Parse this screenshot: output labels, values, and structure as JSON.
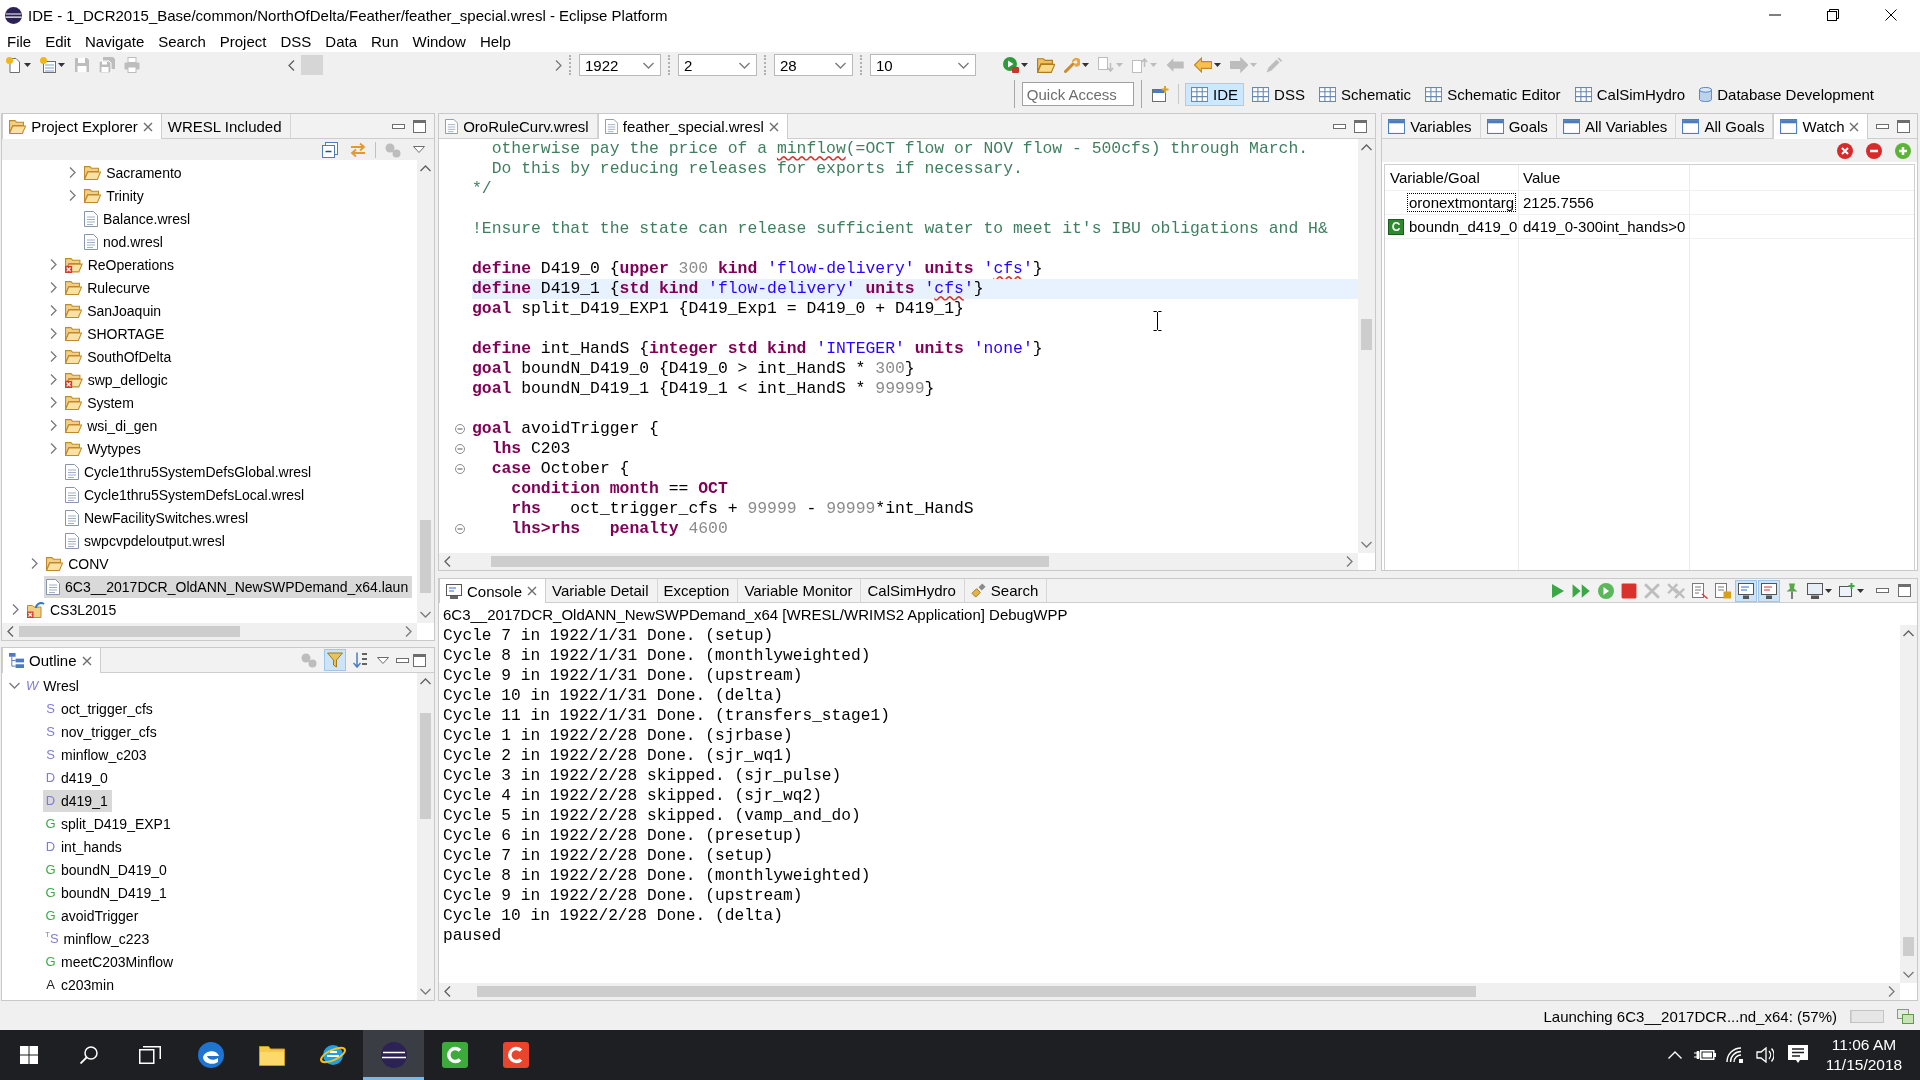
{
  "window": {
    "title": "IDE - 1_DCR2015_Base/common/NorthOfDelta/Feather/feather_special.wresl - Eclipse Platform"
  },
  "menu": [
    "File",
    "Edit",
    "Navigate",
    "Search",
    "Project",
    "DSS",
    "Data",
    "Run",
    "Window",
    "Help"
  ],
  "toolbar": {
    "left_buttons": [
      {
        "kind": "new-file",
        "dropdown": true,
        "disabled": false
      },
      {
        "kind": "new-item",
        "dropdown": true,
        "disabled": false
      },
      {
        "kind": "save",
        "dropdown": false,
        "disabled": true
      },
      {
        "kind": "save-all",
        "dropdown": false,
        "disabled": true
      },
      {
        "kind": "print",
        "dropdown": false,
        "disabled": true
      }
    ],
    "date_fields": [
      {
        "value": "1922"
      },
      {
        "value": "2"
      },
      {
        "value": "28"
      },
      {
        "value": "10"
      }
    ],
    "right_buttons": [
      {
        "kind": "run",
        "dropdown": true,
        "disabled": false
      },
      {
        "kind": "open-folder",
        "dropdown": false,
        "disabled": false
      },
      {
        "kind": "wrench",
        "dropdown": true,
        "disabled": false
      },
      {
        "kind": "next-annotation",
        "dropdown": true,
        "disabled": true
      },
      {
        "kind": "prev-annotation",
        "dropdown": true,
        "disabled": true
      },
      {
        "kind": "last-edit",
        "dropdown": false,
        "disabled": true
      },
      {
        "kind": "back",
        "dropdown": true,
        "disabled": false
      },
      {
        "kind": "forward",
        "dropdown": true,
        "disabled": true
      },
      {
        "kind": "pen",
        "dropdown": false,
        "disabled": true
      }
    ],
    "quick_access": {
      "placeholder": "Quick Access"
    },
    "perspectives": [
      {
        "label": "IDE",
        "kind": "table",
        "selected": true
      },
      {
        "label": "DSS",
        "kind": "table",
        "selected": false
      },
      {
        "label": "Schematic",
        "kind": "table",
        "selected": false
      },
      {
        "label": "Schematic Editor",
        "kind": "table",
        "selected": false
      },
      {
        "label": "CalSimHydro",
        "kind": "table",
        "selected": false
      },
      {
        "label": "Database Development",
        "kind": "database",
        "selected": false
      }
    ]
  },
  "project_explorer": {
    "tabs": [
      {
        "label": "Project Explorer",
        "kind": "explorer",
        "selected": true
      },
      {
        "label": "WRESL Included",
        "kind": "view",
        "selected": false
      }
    ],
    "toolbar": [
      {
        "kind": "collapse-all",
        "disabled": false
      },
      {
        "kind": "link",
        "disabled": false
      },
      {
        "kind": "filters",
        "disabled": true
      },
      {
        "kind": "view-menu",
        "disabled": false
      }
    ],
    "tree": [
      {
        "children": [
          {
            "children": [
              {
                "children": [
                  {
                    "label": "Sacramento",
                    "kind": "folder",
                    "error": false,
                    "expanded": false,
                    "selected": false
                  },
                  {
                    "label": "Trinity",
                    "kind": "folder",
                    "error": false,
                    "expanded": false,
                    "selected": false
                  },
                  {
                    "label": "Balance.wresl",
                    "kind": "file",
                    "selected": false
                  },
                  {
                    "label": "nod.wresl",
                    "kind": "file",
                    "selected": false
                  }
                ]
              },
              {
                "label": "ReOperations",
                "kind": "folder",
                "error": true,
                "expanded": false,
                "selected": false
              },
              {
                "label": "Rulecurve",
                "kind": "folder",
                "error": false,
                "expanded": false,
                "selected": false
              },
              {
                "label": "SanJoaquin",
                "kind": "folder",
                "error": false,
                "expanded": false,
                "selected": false
              },
              {
                "label": "SHORTAGE",
                "kind": "folder",
                "error": false,
                "expanded": false,
                "selected": false
              },
              {
                "label": "SouthOfDelta",
                "kind": "folder",
                "error": false,
                "expanded": false,
                "selected": false
              },
              {
                "label": "swp_dellogic",
                "kind": "folder",
                "error": true,
                "expanded": false,
                "selected": false
              },
              {
                "label": "System",
                "kind": "folder",
                "error": false,
                "expanded": false,
                "selected": false
              },
              {
                "label": "wsi_di_gen",
                "kind": "folder",
                "error": false,
                "expanded": false,
                "selected": false
              },
              {
                "label": "Wytypes",
                "kind": "folder",
                "error": false,
                "expanded": false,
                "selected": false
              },
              {
                "label": "Cycle1thru5SystemDefsGlobal.wresl",
                "kind": "file",
                "selected": false
              },
              {
                "label": "Cycle1thru5SystemDefsLocal.wresl",
                "kind": "file",
                "selected": false
              },
              {
                "label": "NewFacilitySwitches.wresl",
                "kind": "file",
                "selected": false
              },
              {
                "label": "swpcvpdeloutput.wresl",
                "kind": "file",
                "selected": false
              }
            ]
          },
          {
            "label": "CONV",
            "kind": "folder",
            "error": false,
            "expanded": false,
            "selected": false
          },
          {
            "label": "6C3__2017DCR_OldANN_NewSWPDemand_x64.laun",
            "kind": "file",
            "selected": true
          }
        ]
      },
      {
        "label": "CS3L2015",
        "kind": "project",
        "error": true,
        "expanded": false,
        "selected": false
      }
    ]
  },
  "outline": {
    "tabs": [
      {
        "label": "Outline",
        "kind": "outline",
        "selected": true
      }
    ],
    "toolbar": [
      {
        "kind": "filters",
        "disabled": true,
        "pressed": false
      },
      {
        "kind": "hide-fields",
        "disabled": false,
        "pressed": true
      },
      {
        "kind": "sort",
        "disabled": false,
        "pressed": false
      },
      {
        "kind": "view-menu",
        "disabled": false,
        "pressed": false
      }
    ],
    "tree": [
      {
        "label": "Wresl",
        "badge": "W",
        "kind": "root",
        "expanded": true,
        "selected": false,
        "children": [
          {
            "label": "oct_trigger_cfs",
            "badge": "S",
            "kind": "svar",
            "selected": false
          },
          {
            "label": "nov_trigger_cfs",
            "badge": "S",
            "kind": "svar",
            "selected": false
          },
          {
            "label": "minflow_c203",
            "badge": "S",
            "kind": "svar",
            "selected": false
          },
          {
            "label": "d419_0",
            "badge": "D",
            "kind": "dvar",
            "selected": false
          },
          {
            "label": "d419_1",
            "badge": "D",
            "kind": "dvar",
            "selected": true
          },
          {
            "label": "split_D419_EXP1",
            "badge": "G",
            "kind": "goal",
            "selected": false
          },
          {
            "label": "int_hands",
            "badge": "D",
            "kind": "dvar",
            "selected": false
          },
          {
            "label": "boundN_D419_0",
            "badge": "G",
            "kind": "goal",
            "selected": false
          },
          {
            "label": "boundN_D419_1",
            "badge": "G",
            "kind": "goal",
            "selected": false
          },
          {
            "label": "avoidTrigger",
            "badge": "G",
            "kind": "goal",
            "selected": false
          },
          {
            "label": "minflow_c223",
            "badge": "$^{T}$S",
            "kind": "svar",
            "selected": false
          },
          {
            "label": "meetC203Minflow",
            "badge": "G",
            "kind": "goal",
            "selected": false
          },
          {
            "label": "c203min",
            "badge": "A",
            "kind": "alias",
            "selected": false
          }
        ]
      }
    ]
  },
  "editor": {
    "tabs": [
      {
        "label": "OroRuleCurv.wresl",
        "selected": false
      },
      {
        "label": "feather_special.wresl",
        "selected": true
      }
    ],
    "lines": [
      {
        "fold": false,
        "current": false,
        "tokens": [
          {
            "kind": "comment",
            "text": "  otherwise pay the price of a "
          },
          {
            "kind": "comment",
            "text": "minflow",
            "misspelled": true
          },
          {
            "kind": "comment",
            "text": "(=OCT flow or NOV flow - 500cfs) through March."
          }
        ]
      },
      {
        "fold": false,
        "current": false,
        "tokens": [
          {
            "kind": "comment",
            "text": "  Do this by reducing releases for exports if necessary."
          }
        ]
      },
      {
        "fold": false,
        "current": false,
        "tokens": [
          {
            "kind": "comment",
            "text": "*/"
          }
        ]
      },
      {
        "fold": false,
        "current": false
      },
      {
        "fold": false,
        "current": false,
        "tokens": [
          {
            "kind": "comment",
            "text": "!Ensure that the state can release sufficient water to meet it's IBU obligations and H&"
          }
        ]
      },
      {
        "fold": false,
        "current": false
      },
      {
        "fold": false,
        "current": false,
        "tokens": [
          {
            "kind": "keyword",
            "text": "define"
          },
          {
            "kind": "plain",
            "text": " D419_0 {"
          },
          {
            "kind": "keyword",
            "text": "upper"
          },
          {
            "kind": "number",
            "text": " 300 "
          },
          {
            "kind": "keyword",
            "text": "kind"
          },
          {
            "kind": "string",
            "text": " 'flow-delivery' "
          },
          {
            "kind": "keyword",
            "text": "units"
          },
          {
            "kind": "string",
            "text": " '"
          },
          {
            "kind": "string",
            "text": "cfs",
            "misspelled": true
          },
          {
            "kind": "string",
            "text": "'"
          },
          {
            "kind": "plain",
            "text": "}"
          }
        ]
      },
      {
        "fold": false,
        "current": true,
        "tokens": [
          {
            "kind": "keyword",
            "text": "define"
          },
          {
            "kind": "plain",
            "text": " D419_1 {"
          },
          {
            "kind": "keyword",
            "text": "std kind"
          },
          {
            "kind": "string",
            "text": " 'flow-delivery' "
          },
          {
            "kind": "keyword",
            "text": "units"
          },
          {
            "kind": "string",
            "text": " '"
          },
          {
            "kind": "string",
            "text": "cfs",
            "misspelled": true
          },
          {
            "kind": "string",
            "text": "'"
          },
          {
            "kind": "plain",
            "text": "}"
          }
        ]
      },
      {
        "fold": false,
        "current": false,
        "tokens": [
          {
            "kind": "keyword",
            "text": "goal"
          },
          {
            "kind": "plain",
            "text": " split_D419_EXP1 {D419_Exp1 = D419_0 + D419_1}"
          }
        ]
      },
      {
        "fold": false,
        "current": false
      },
      {
        "fold": false,
        "current": false,
        "tokens": [
          {
            "kind": "keyword",
            "text": "define"
          },
          {
            "kind": "plain",
            "text": " int_HandS {"
          },
          {
            "kind": "keyword",
            "text": "integer std kind"
          },
          {
            "kind": "string",
            "text": " 'INTEGER' "
          },
          {
            "kind": "keyword",
            "text": "units"
          },
          {
            "kind": "string",
            "text": " 'none'"
          },
          {
            "kind": "plain",
            "text": "}"
          }
        ]
      },
      {
        "fold": false,
        "current": false,
        "tokens": [
          {
            "kind": "keyword",
            "text": "goal"
          },
          {
            "kind": "plain",
            "text": " boundN_D419_0 {D419_0 > int_HandS * "
          },
          {
            "kind": "number",
            "text": "300"
          },
          {
            "kind": "plain",
            "text": "}"
          }
        ]
      },
      {
        "fold": false,
        "current": false,
        "tokens": [
          {
            "kind": "keyword",
            "text": "goal"
          },
          {
            "kind": "plain",
            "text": " boundN_D419_1 {D419_1 < int_HandS * "
          },
          {
            "kind": "number",
            "text": "99999"
          },
          {
            "kind": "plain",
            "text": "}"
          }
        ]
      },
      {
        "fold": false,
        "current": false
      },
      {
        "fold": true,
        "current": false,
        "tokens": [
          {
            "kind": "keyword",
            "text": "goal"
          },
          {
            "kind": "plain",
            "text": " avoidTrigger {"
          }
        ]
      },
      {
        "fold": true,
        "current": false,
        "tokens": [
          {
            "kind": "keyword",
            "text": "  lhs"
          },
          {
            "kind": "plain",
            "text": " C203"
          }
        ]
      },
      {
        "fold": true,
        "current": false,
        "tokens": [
          {
            "kind": "keyword",
            "text": "  case"
          },
          {
            "kind": "plain",
            "text": " October {"
          }
        ]
      },
      {
        "fold": false,
        "current": false,
        "tokens": [
          {
            "kind": "keyword",
            "text": "    condition month"
          },
          {
            "kind": "plain",
            "text": " == "
          },
          {
            "kind": "keyword",
            "text": "OCT"
          }
        ]
      },
      {
        "fold": false,
        "current": false,
        "tokens": [
          {
            "kind": "keyword",
            "text": "    rhs"
          },
          {
            "kind": "plain",
            "text": "   oct_trigger_cfs + "
          },
          {
            "kind": "number",
            "text": "99999"
          },
          {
            "kind": "plain",
            "text": " - "
          },
          {
            "kind": "number",
            "text": "99999"
          },
          {
            "kind": "plain",
            "text": "*int_HandS"
          }
        ]
      },
      {
        "fold": true,
        "current": false,
        "tokens": [
          {
            "kind": "keyword",
            "text": "    lhs>rhs   penalty"
          },
          {
            "kind": "number",
            "text": " 4600"
          }
        ]
      }
    ]
  },
  "watch": {
    "tabs": [
      {
        "label": "Variables",
        "selected": false
      },
      {
        "label": "Goals",
        "selected": false
      },
      {
        "label": "All Variables",
        "selected": false
      },
      {
        "label": "All Goals",
        "selected": false
      },
      {
        "label": "Watch",
        "selected": true
      }
    ],
    "columns": [
      "Variable/Goal",
      "Value"
    ],
    "rows": [
      {
        "name": "oronextmontarg",
        "value": "2125.7556",
        "focused": true
      },
      {
        "badge": "C",
        "name": "boundn_d419_0",
        "value": "d419_0-300int_hands>0",
        "focused": false
      }
    ]
  },
  "console": {
    "tabs": [
      {
        "label": "Console",
        "kind": "console",
        "selected": true
      },
      {
        "label": "Variable Detail",
        "kind": "view",
        "selected": false
      },
      {
        "label": "Exception",
        "kind": "view",
        "selected": false
      },
      {
        "label": "Variable Monitor",
        "kind": "view",
        "selected": false
      },
      {
        "label": "CalSimHydro",
        "kind": "view",
        "selected": false
      },
      {
        "label": "Search",
        "kind": "search",
        "selected": false
      }
    ],
    "toolbar": [
      {
        "kind": "resume",
        "dropdown": false,
        "disabled": false,
        "pressed": false
      },
      {
        "kind": "step-over",
        "dropdown": false,
        "disabled": false,
        "pressed": false
      },
      {
        "kind": "step-return",
        "dropdown": false,
        "disabled": false,
        "pressed": false
      },
      {
        "kind": "terminate",
        "dropdown": false,
        "disabled": false,
        "pressed": false
      },
      {
        "kind": "remove",
        "dropdown": false,
        "disabled": true,
        "pressed": false
      },
      {
        "kind": "remove-all",
        "dropdown": false,
        "disabled": true,
        "pressed": false
      },
      {
        "kind": "clear",
        "dropdown": false,
        "disabled": false,
        "pressed": false
      },
      {
        "kind": "scroll-lock",
        "dropdown": false,
        "disabled": false,
        "pressed": false
      },
      {
        "kind": "show-out",
        "dropdown": false,
        "disabled": false,
        "pressed": true
      },
      {
        "kind": "show-err",
        "dropdown": false,
        "disabled": false,
        "pressed": true
      },
      {
        "kind": "pin",
        "dropdown": false,
        "disabled": false,
        "pressed": false
      },
      {
        "kind": "display-console",
        "dropdown": true,
        "disabled": false,
        "pressed": false
      },
      {
        "kind": "open-console",
        "dropdown": true,
        "disabled": false,
        "pressed": false
      }
    ],
    "process": "6C3__2017DCR_OldANN_NewSWPDemand_x64 [WRESL/WRIMS2 Application] DebugWPP",
    "lines": [
      "Cycle 7 in 1922/1/31 Done. (setup)",
      "Cycle 8 in 1922/1/31 Done. (monthlyweighted)",
      "Cycle 9 in 1922/1/31 Done. (upstream)",
      "Cycle 10 in 1922/1/31 Done. (delta)",
      "Cycle 11 in 1922/1/31 Done. (transfers_stage1)",
      "Cycle 1 in 1922/2/28 Done. (sjrbase)",
      "Cycle 2 in 1922/2/28 Done. (sjr_wq1)",
      "Cycle 3 in 1922/2/28 skipped. (sjr_pulse)",
      "Cycle 4 in 1922/2/28 skipped. (sjr_wq2)",
      "Cycle 5 in 1922/2/28 skipped. (vamp_and_do)",
      "Cycle 6 in 1922/2/28 Done. (presetup)",
      "Cycle 7 in 1922/2/28 Done. (setup)",
      "Cycle 8 in 1922/2/28 Done. (monthlyweighted)",
      "Cycle 9 in 1922/2/28 Done. (upstream)",
      "Cycle 10 in 1922/2/28 Done. (delta)",
      "paused"
    ]
  },
  "status_bar": {
    "message": "Launching 6C3__2017DCR...nd_x64: (57%)",
    "progress": {
      "level": 0
    }
  },
  "taskbar": {
    "apps": [
      {
        "kind": "browser",
        "active": false
      },
      {
        "kind": "files",
        "active": false
      },
      {
        "kind": "browser-legacy",
        "active": false
      },
      {
        "kind": "ide",
        "active": true
      },
      {
        "kind": "recorder",
        "active": false
      },
      {
        "kind": "video-editor",
        "active": false
      }
    ],
    "clock": {
      "time": "11:06 AM",
      "date": "11/15/2018"
    }
  }
}
